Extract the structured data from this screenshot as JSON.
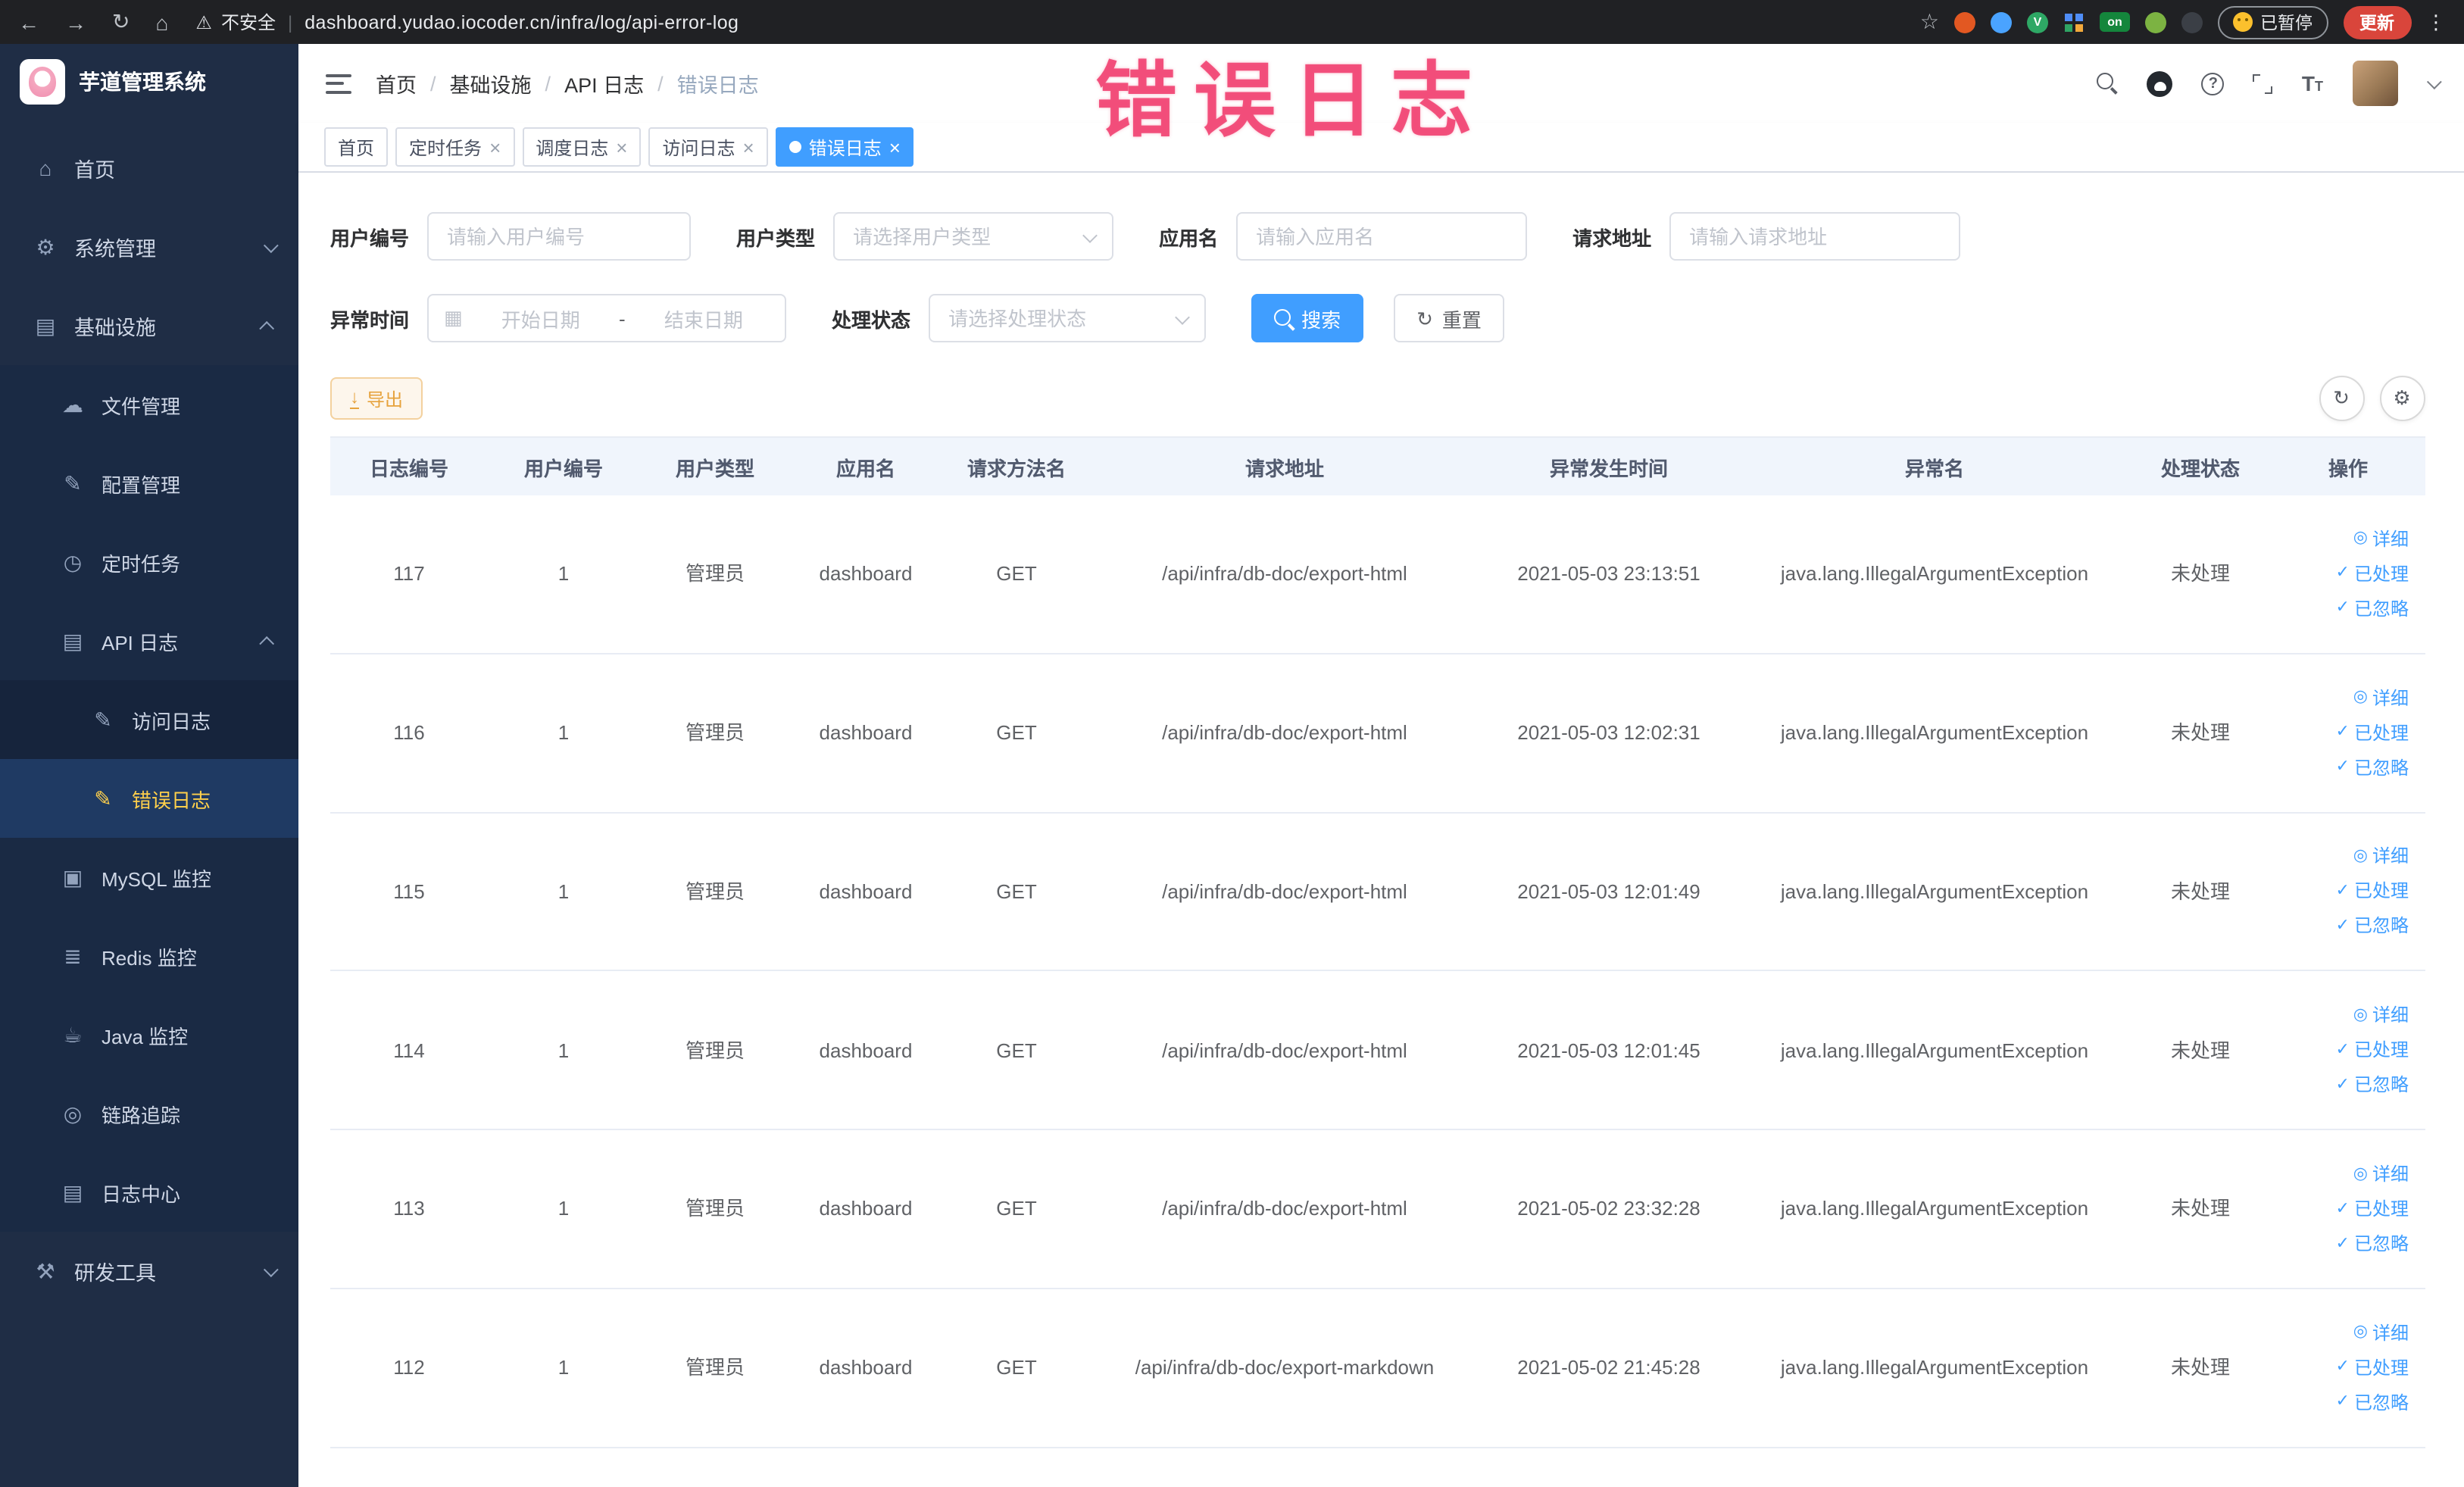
{
  "browser": {
    "security_label": "不安全",
    "url": "dashboard.yudao.iocoder.cn/infra/log/api-error-log",
    "extension_badge": "on",
    "vue_badge": "V",
    "paused_label": "已暂停",
    "update_label": "更新"
  },
  "annotation": {
    "text": "错误日志"
  },
  "sidebar": {
    "logo_title": "芋道管理系统",
    "menu": [
      {
        "name": "home",
        "label": "首页",
        "icon": "home-icon",
        "level": 1
      },
      {
        "name": "system-management",
        "label": "系统管理",
        "icon": "gear-icon",
        "level": 1,
        "arrow": "down"
      },
      {
        "name": "infrastructure",
        "label": "基础设施",
        "icon": "infra-icon",
        "level": 1,
        "arrow": "up"
      },
      {
        "name": "file-management",
        "label": "文件管理",
        "icon": "file-icon",
        "level": 2
      },
      {
        "name": "config-management",
        "label": "配置管理",
        "icon": "config-icon",
        "level": 2
      },
      {
        "name": "scheduled-jobs",
        "label": "定时任务",
        "icon": "job-icon",
        "level": 2
      },
      {
        "name": "api-log",
        "label": "API 日志",
        "icon": "api-log-icon",
        "level": 2,
        "arrow": "up"
      },
      {
        "name": "access-log",
        "label": "访问日志",
        "icon": "access-log-icon",
        "level": 3
      },
      {
        "name": "error-log",
        "label": "错误日志",
        "icon": "error-log-icon",
        "level": 3,
        "active": true
      },
      {
        "name": "mysql-monitor",
        "label": "MySQL 监控",
        "icon": "mysql-icon",
        "level": 2
      },
      {
        "name": "redis-monitor",
        "label": "Redis 监控",
        "icon": "redis-icon",
        "level": 2
      },
      {
        "name": "java-monitor",
        "label": "Java 监控",
        "icon": "java-icon",
        "level": 2
      },
      {
        "name": "trace",
        "label": "链路追踪",
        "icon": "trace-icon",
        "level": 2
      },
      {
        "name": "log-center",
        "label": "日志中心",
        "icon": "log-center-icon",
        "level": 2
      },
      {
        "name": "dev-tools",
        "label": "研发工具",
        "icon": "tools-icon",
        "level": 1,
        "arrow": "down"
      }
    ]
  },
  "header": {
    "breadcrumb": [
      "首页",
      "基础设施",
      "API 日志",
      "错误日志"
    ]
  },
  "tabs": [
    {
      "name": "home",
      "label": "首页",
      "closable": false,
      "active": false
    },
    {
      "name": "scheduled-jobs",
      "label": "定时任务",
      "closable": true,
      "active": false
    },
    {
      "name": "schedule-log",
      "label": "调度日志",
      "closable": true,
      "active": false
    },
    {
      "name": "access-log",
      "label": "访问日志",
      "closable": true,
      "active": false
    },
    {
      "name": "error-log",
      "label": "错误日志",
      "closable": true,
      "active": true
    }
  ],
  "filters": {
    "user_id": {
      "label": "用户编号",
      "placeholder": "请输入用户编号"
    },
    "user_type": {
      "label": "用户类型",
      "placeholder": "请选择用户类型"
    },
    "app_name": {
      "label": "应用名",
      "placeholder": "请输入应用名"
    },
    "request_url": {
      "label": "请求地址",
      "placeholder": "请输入请求地址"
    },
    "exception_time": {
      "label": "异常时间",
      "start_placeholder": "开始日期",
      "separator": "-",
      "end_placeholder": "结束日期"
    },
    "process_status": {
      "label": "处理状态",
      "placeholder": "请选择处理状态"
    },
    "search_label": "搜索",
    "reset_label": "重置"
  },
  "toolbar": {
    "export_label": "导出"
  },
  "table": {
    "columns": [
      "日志编号",
      "用户编号",
      "用户类型",
      "应用名",
      "请求方法名",
      "请求地址",
      "异常发生时间",
      "异常名",
      "处理状态",
      "操作"
    ],
    "actions": [
      "详细",
      "已处理",
      "已忽略"
    ],
    "rows": [
      {
        "id": "117",
        "user_id": "1",
        "user_type": "管理员",
        "app": "dashboard",
        "method": "GET",
        "url": "/api/infra/db-doc/export-html",
        "time": "2021-05-03 23:13:51",
        "exception": "java.lang.IllegalArgumentException",
        "status": "未处理"
      },
      {
        "id": "116",
        "user_id": "1",
        "user_type": "管理员",
        "app": "dashboard",
        "method": "GET",
        "url": "/api/infra/db-doc/export-html",
        "time": "2021-05-03 12:02:31",
        "exception": "java.lang.IllegalArgumentException",
        "status": "未处理"
      },
      {
        "id": "115",
        "user_id": "1",
        "user_type": "管理员",
        "app": "dashboard",
        "method": "GET",
        "url": "/api/infra/db-doc/export-html",
        "time": "2021-05-03 12:01:49",
        "exception": "java.lang.IllegalArgumentException",
        "status": "未处理"
      },
      {
        "id": "114",
        "user_id": "1",
        "user_type": "管理员",
        "app": "dashboard",
        "method": "GET",
        "url": "/api/infra/db-doc/export-html",
        "time": "2021-05-03 12:01:45",
        "exception": "java.lang.IllegalArgumentException",
        "status": "未处理"
      },
      {
        "id": "113",
        "user_id": "1",
        "user_type": "管理员",
        "app": "dashboard",
        "method": "GET",
        "url": "/api/infra/db-doc/export-html",
        "time": "2021-05-02 23:32:28",
        "exception": "java.lang.IllegalArgumentException",
        "status": "未处理"
      },
      {
        "id": "112",
        "user_id": "1",
        "user_type": "管理员",
        "app": "dashboard",
        "method": "GET",
        "url": "/api/infra/db-doc/export-markdown",
        "time": "2021-05-02 21:45:28",
        "exception": "java.lang.IllegalArgumentException",
        "status": "未处理"
      }
    ]
  },
  "colors": {
    "accent_blue": "#409eff",
    "warning_orange": "#e6a23c",
    "sidebar_bg": "#1f2d45",
    "sidebar_active_text": "#ffd04b",
    "annotation_pink": "#f03e6e",
    "chrome_bg": "#202124",
    "update_button_red": "#d9453b",
    "table_header_bg": "#f0f5fc"
  }
}
